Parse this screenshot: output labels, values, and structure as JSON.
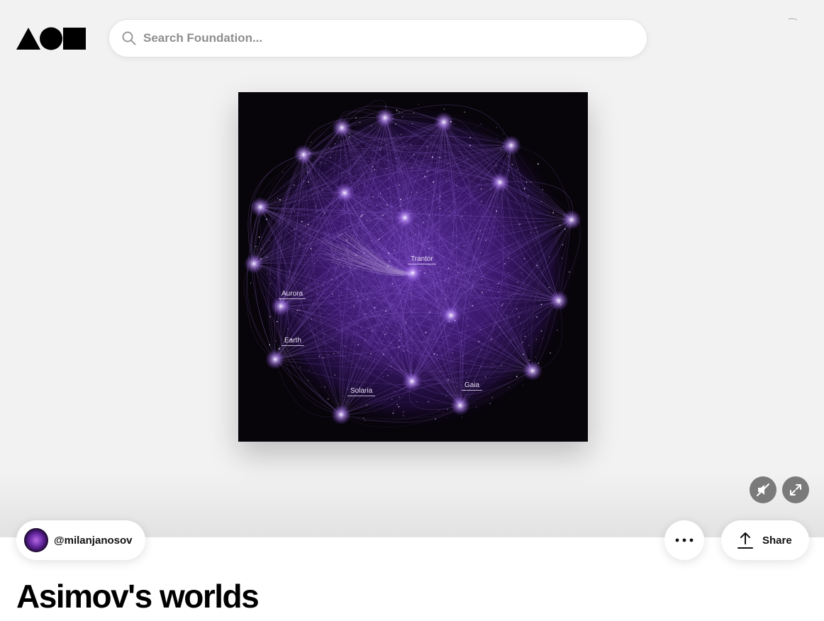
{
  "header": {
    "logo_icon": "foundation-logo-icon",
    "search": {
      "placeholder": "Search Foundation...",
      "value": "",
      "icon": "search-icon"
    }
  },
  "artwork": {
    "labels": {
      "trantor": "Trantor",
      "aurora": "Aurora",
      "earth": "Earth",
      "solaria": "Solaria",
      "gaia": "Gaia"
    },
    "background_color": "#07040a",
    "glow_color": "#a066ff"
  },
  "media_controls": {
    "mute_icon": "muted-speaker-icon",
    "fullscreen_icon": "expand-icon"
  },
  "creator": {
    "handle": "@milanjanosov"
  },
  "actions": {
    "more_icon": "more-dots-icon",
    "share_label": "Share",
    "share_icon": "upload-share-icon"
  },
  "nft": {
    "title": "Asimov's worlds"
  }
}
